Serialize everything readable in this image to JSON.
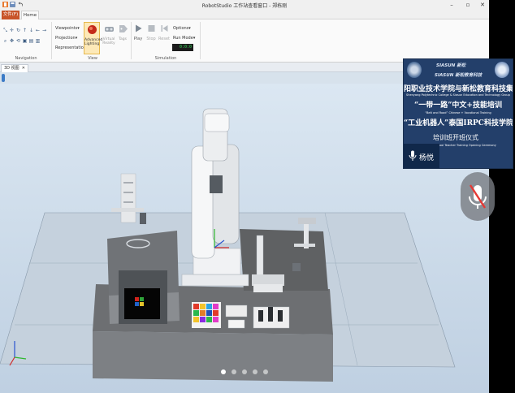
{
  "window": {
    "title": "RobotStudio 工作站查看窗口 - 郑栋刚"
  },
  "ribbon": {
    "file_tab": "文件(F)",
    "home_tab": "Home",
    "navigation": {
      "label": "Navigation"
    },
    "view": {
      "label": "View",
      "viewpoints": "Viewpoints",
      "projection": "Projection",
      "representation": "Representation",
      "advanced_lighting": "Advanced Lighting",
      "virtual_reality": "Virtual Reality",
      "tags": "Tags"
    },
    "simulation": {
      "label": "Simulation",
      "play": "Play",
      "stop": "Stop",
      "reset": "Reset",
      "options": "Options",
      "run_mode": "Run Mode",
      "clock": "0:0:0"
    }
  },
  "document": {
    "tab_label": "3D 视图"
  },
  "overlay": {
    "brand_1": "SIASUN 新松",
    "brand_2": "SIASUN 新松教育科技",
    "line_1": "阳职业技术学院与新松教育科技集",
    "line_1_en": "Shenyang Polytechnic College & Siasun Education and Technology Group",
    "line_2": "“一带一路”中文+技能培训",
    "line_2_en": "“Belt and Road” Chinese + Vocational Training",
    "line_3": "“工业机器人”泰国IRPC科技学院",
    "line_4": "培训班开班仪式",
    "line_4_en": "ool Teacher Training Opening Ceremony",
    "speaker": "杨悦"
  },
  "colors": {
    "file_tab": "#c8542a",
    "viewport_top": "#dbe7f2",
    "overlay_bg": "#233f6a",
    "clock_text": "#34e05a",
    "scroll_thumb": "#3c7bc6"
  },
  "carousel": {
    "count": 5,
    "active": 1
  }
}
